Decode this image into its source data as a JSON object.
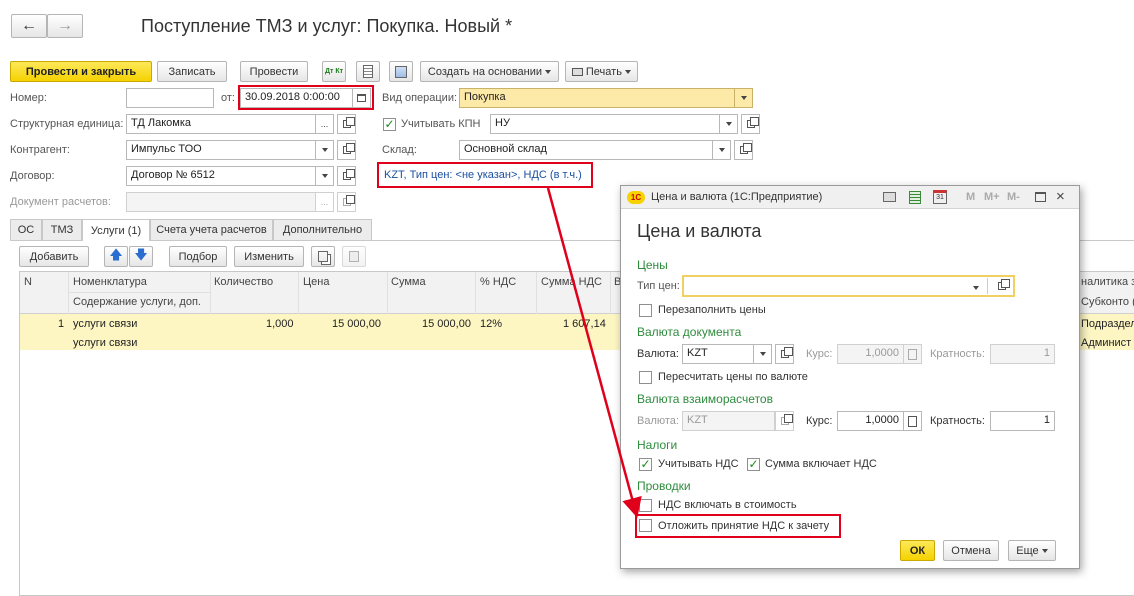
{
  "doc": {
    "title": "Поступление ТМЗ и услуг: Покупка. Новый *",
    "toolbar": {
      "post_close": "Провести и закрыть",
      "save": "Записать",
      "post": "Провести",
      "dt_kt": "Дт Кт",
      "create_based": "Создать на основании",
      "print": "Печать"
    },
    "fields": {
      "number_label": "Номер:",
      "number_value": "",
      "date_label": "от:",
      "date_value": "30.09.2018  0:00:00",
      "op_label": "Вид операции:",
      "op_value": "Покупка",
      "unit_label": "Структурная единица:",
      "unit_value": "ТД Лакомка",
      "kpn_label": "Учитывать КПН",
      "kpn_value": "НУ",
      "counterparty_label": "Контрагент:",
      "counterparty_value": "Импульс ТОО",
      "warehouse_label": "Склад:",
      "warehouse_value": "Основной склад",
      "contract_label": "Договор:",
      "contract_value": "Договор № 6512",
      "price_link": "KZT, Тип цен: <не указан>, НДС (в т.ч.)",
      "settlement_doc_label": "Документ расчетов:"
    },
    "tabs": [
      "ОС",
      "ТМЗ",
      "Услуги (1)",
      "Счета учета расчетов",
      "Дополнительно"
    ],
    "table_toolbar": {
      "add": "Добавить",
      "pick": "Подбор",
      "change": "Изменить"
    },
    "table": {
      "headers": {
        "n": "N",
        "nomenclature": "Номенклатура",
        "content": "Содержание услуги, доп.",
        "qty": "Количество",
        "price": "Цена",
        "sum": "Сумма",
        "vat_pct": "% НДС",
        "vat_sum": "Сумма НДС",
        "col_v": "В",
        "analytics": "налитика з",
        "subkonto": "Субконто (I"
      },
      "row": {
        "n": "1",
        "nomenclature": "услуги связи",
        "content": "услуги связи",
        "qty": "1,000",
        "price": "15 000,00",
        "sum": "15 000,00",
        "vat_pct": "12%",
        "vat_sum": "1 607,14",
        "analytics1": "Подраздел",
        "analytics2": "Админист"
      }
    }
  },
  "dialog": {
    "window_title": "Цена и валюта  (1С:Предприятие)",
    "app_logo": "1С",
    "memory_buttons": [
      "M",
      "M+",
      "M-"
    ],
    "heading": "Цена и валюта",
    "prices_section": "Цены",
    "price_type_label": "Тип цен:",
    "price_type_value": "",
    "refill_prices": "Перезаполнить цены",
    "doc_currency_section": "Валюта документа",
    "currency_label": "Валюта:",
    "currency_value": "KZT",
    "rate_label": "Курс:",
    "rate_value": "1,0000",
    "multiplicity_label": "Кратность:",
    "multiplicity_value": "1",
    "recalc_prices": "Пересчитать цены по валюте",
    "settlement_section": "Валюта взаиморасчетов",
    "currency2_label": "Валюта:",
    "currency2_value": "KZT",
    "rate2_label": "Курс:",
    "rate2_value": "1,0000",
    "multiplicity2_label": "Кратность:",
    "multiplicity2_value": "1",
    "taxes_section": "Налоги",
    "consider_vat": "Учитывать НДС",
    "sum_includes_vat": "Сумма включает НДС",
    "postings_section": "Проводки",
    "vat_in_cost": "НДС включать в стоимость",
    "defer_vat": "Отложить принятие НДС к зачету",
    "ok": "ОК",
    "cancel": "Отмена",
    "more": "Еще",
    "calendar_day": "31"
  },
  "colors": {
    "accent_yellow": "#f5d200",
    "highlight_red": "#e0001b",
    "section_green": "#2e8b3d",
    "link_blue": "#1a4fa0",
    "row_yellow": "#fdf6c3"
  }
}
